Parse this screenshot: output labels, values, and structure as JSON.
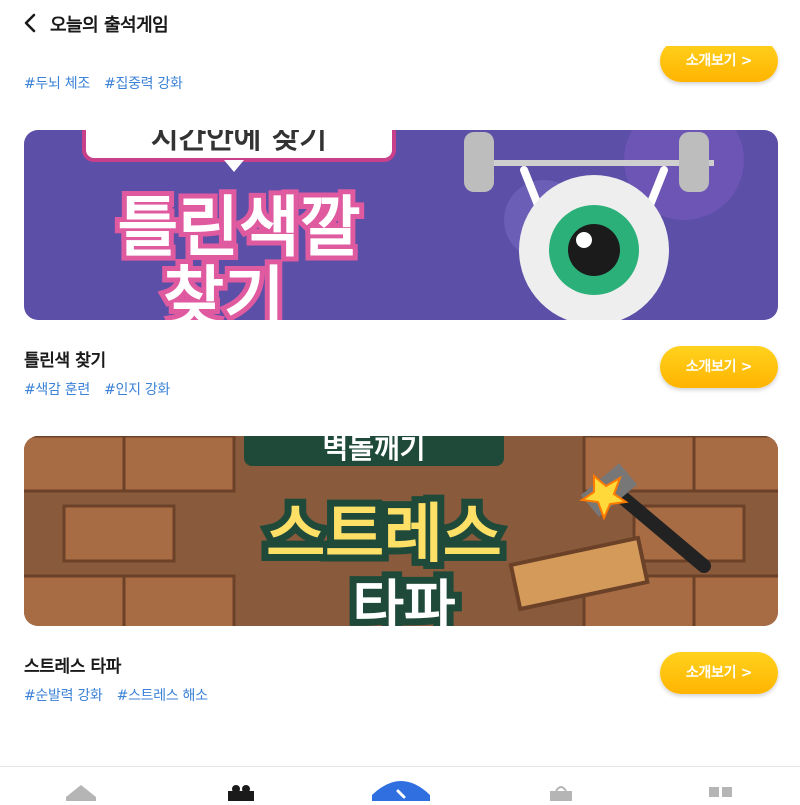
{
  "header": {
    "title": "오늘의 출석게임"
  },
  "games": [
    {
      "title": "",
      "tags": [
        "#두뇌 체조",
        "#집중력 강화"
      ],
      "button_label": "소개보기 >"
    },
    {
      "title": "틀린색 찾기",
      "tags": [
        "#색감 훈련",
        "#인지 강화"
      ],
      "button_label": "소개보기 >",
      "banner": {
        "top_text": "시간안에 찾기",
        "main_text": "틀린색깔",
        "sub_text": "찾기"
      }
    },
    {
      "title": "스트레스 타파",
      "tags": [
        "#순발력 강화",
        "#스트레스 해소"
      ],
      "button_label": "소개보기 >",
      "banner": {
        "top_text": "벽돌깨기",
        "main_text": "스트레스",
        "sub_text": "타파"
      }
    }
  ],
  "bottom_nav": {
    "items": [
      "home-icon",
      "gift-icon",
      "game-icon",
      "shop-icon",
      "menu-icon"
    ]
  },
  "colors": {
    "accent": "#ffc107",
    "tag": "#3b82d6",
    "banner1_bg": "#5b4fa8",
    "banner2_bg": "#8a5a3c"
  }
}
